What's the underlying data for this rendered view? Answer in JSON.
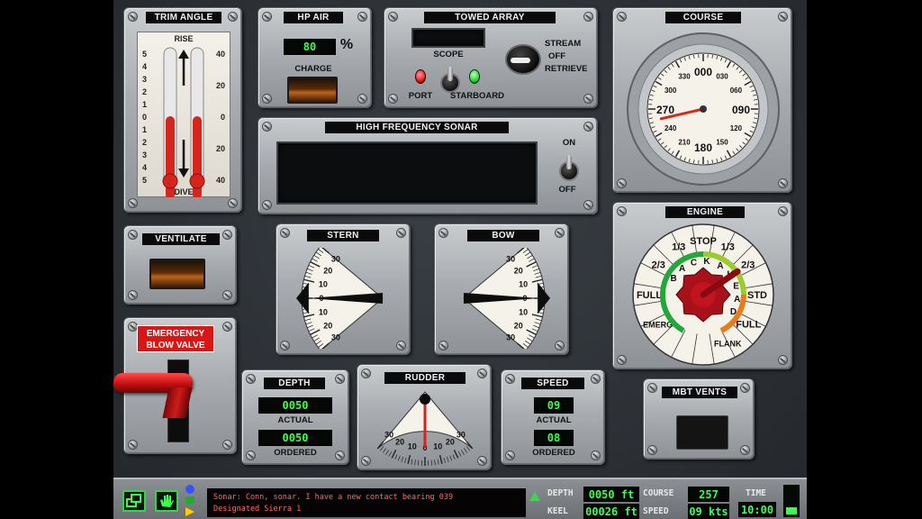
{
  "trim_angle": {
    "title": "TRIM ANGLE",
    "rise": "RISE",
    "dive": "DIVE",
    "left_scale": [
      "5",
      "4",
      "3",
      "2",
      "1",
      "0",
      "1",
      "2",
      "3",
      "4",
      "5"
    ],
    "right_scale": [
      "40",
      "20",
      "0",
      "20",
      "40"
    ]
  },
  "hp_air": {
    "title": "HP AIR",
    "value": "80",
    "unit": "%",
    "charge_label": "CHARGE"
  },
  "towed_array": {
    "title": "TOWED ARRAY",
    "scope_label": "SCOPE",
    "port_label": "PORT",
    "starboard_label": "STARBOARD",
    "stream": "STREAM",
    "off": "OFF",
    "retrieve": "RETRIEVE",
    "port_light": "#e0201a",
    "starboard_light": "#2bd43a"
  },
  "course_gauge": {
    "title": "COURSE",
    "labels": [
      {
        "text": "000",
        "deg": 0
      },
      {
        "text": "030",
        "deg": 30
      },
      {
        "text": "060",
        "deg": 60
      },
      {
        "text": "090",
        "deg": 90
      },
      {
        "text": "120",
        "deg": 120
      },
      {
        "text": "150",
        "deg": 150
      },
      {
        "text": "180",
        "deg": 180
      },
      {
        "text": "210",
        "deg": 210
      },
      {
        "text": "240",
        "deg": 240
      },
      {
        "text": "270",
        "deg": 270
      },
      {
        "text": "300",
        "deg": 300
      },
      {
        "text": "330",
        "deg": 330
      }
    ],
    "heading_deg": 257
  },
  "sonar": {
    "title": "HIGH FREQUENCY SONAR",
    "on": "ON",
    "off": "OFF"
  },
  "ventilate": {
    "title": "VENTILATE"
  },
  "emergency": {
    "label_line1": "EMERGENCY",
    "label_line2": "BLOW VALVE"
  },
  "stern": {
    "title": "STERN",
    "scale": [
      "30",
      "20",
      "10",
      "0",
      "10",
      "20",
      "30"
    ],
    "angle_deg": 0
  },
  "bow": {
    "title": "BOW",
    "scale": [
      "30",
      "20",
      "10",
      "0",
      "10",
      "20",
      "30"
    ],
    "angle_deg": 0
  },
  "engine": {
    "title": "ENGINE",
    "orders": [
      {
        "text": "STOP",
        "deg": 0
      },
      {
        "text": "1/3",
        "deg": 27
      },
      {
        "text": "2/3",
        "deg": 56
      },
      {
        "text": "STD",
        "deg": 90
      },
      {
        "text": "FULL",
        "deg": 123
      },
      {
        "text": "FLANK",
        "deg": 153
      },
      {
        "text": "1/3",
        "deg": -27
      },
      {
        "text": "2/3",
        "deg": -56
      },
      {
        "text": "FULL",
        "deg": -90
      },
      {
        "text": "EMERG",
        "deg": -123
      }
    ],
    "back_letters": [
      "B",
      "A",
      "C",
      "K"
    ],
    "ahead_letters": [
      "A",
      "H",
      "E",
      "A",
      "D"
    ],
    "telegraph_deg": 56
  },
  "mbt_vents": {
    "title": "MBT VENTS"
  },
  "depth": {
    "title": "DEPTH",
    "actual": "0050",
    "actual_label": "ACTUAL",
    "ordered": "0050",
    "ordered_label": "ORDERED"
  },
  "rudder": {
    "title": "RUDDER",
    "scale": [
      "30",
      "20",
      "10",
      "0",
      "10",
      "20",
      "30"
    ],
    "angle_deg": 0
  },
  "speed": {
    "title": "SPEED",
    "actual": "09",
    "actual_label": "ACTUAL",
    "ordered": "08",
    "ordered_label": "ORDERED"
  },
  "status_bar": {
    "message_line1": "Sonar: Conn, sonar. I have a new contact bearing 039",
    "message_line2": "Designated Sierra 1",
    "depth_label": "DEPTH",
    "depth_value": "0050 ft",
    "keel_label": "KEEL",
    "keel_value": "00026 ft",
    "course_label": "COURSE",
    "course_value": "257",
    "speed_label": "SPEED",
    "speed_value": "09 kts",
    "time_label": "TIME",
    "time_value": "10:00"
  }
}
